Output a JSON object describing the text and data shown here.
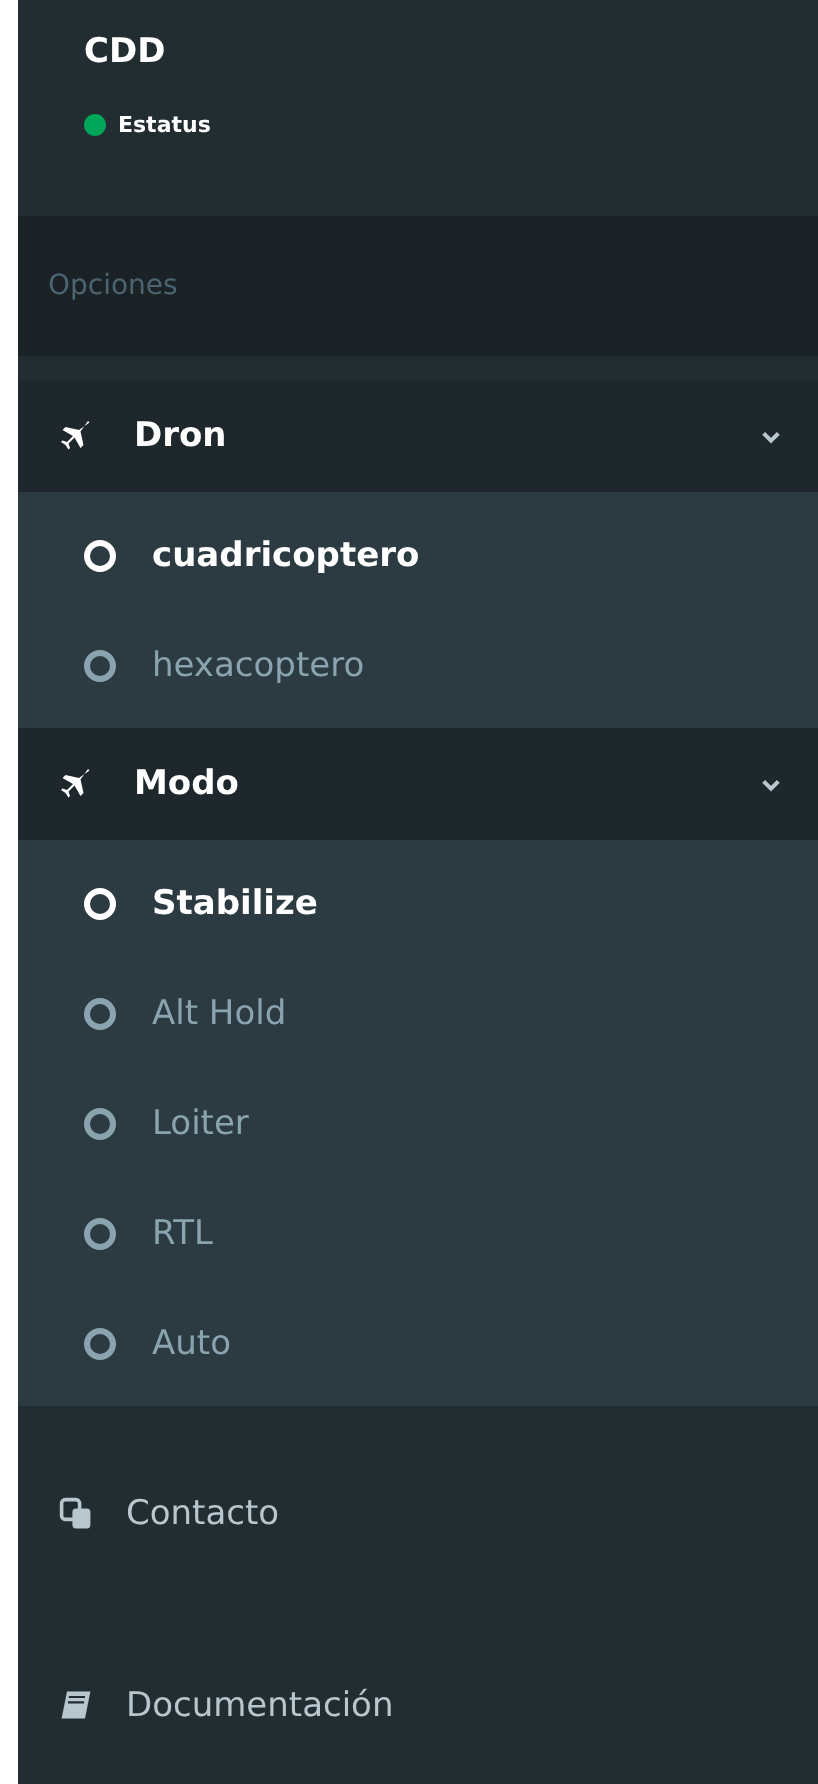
{
  "user": {
    "name": "CDD",
    "status": "Estatus"
  },
  "section_header": "Opciones",
  "menus": [
    {
      "label": "Dron",
      "expanded": true,
      "items": [
        {
          "label": "cuadricoptero",
          "selected": true
        },
        {
          "label": "hexacoptero",
          "selected": false
        }
      ]
    },
    {
      "label": "Modo",
      "expanded": true,
      "items": [
        {
          "label": "Stabilize",
          "selected": true
        },
        {
          "label": "Alt Hold",
          "selected": false
        },
        {
          "label": "Loiter",
          "selected": false
        },
        {
          "label": "RTL",
          "selected": false
        },
        {
          "label": "Auto",
          "selected": false
        }
      ]
    }
  ],
  "links": [
    {
      "label": "Contacto",
      "kind": "contact"
    },
    {
      "label": "Documentación",
      "kind": "book"
    }
  ]
}
